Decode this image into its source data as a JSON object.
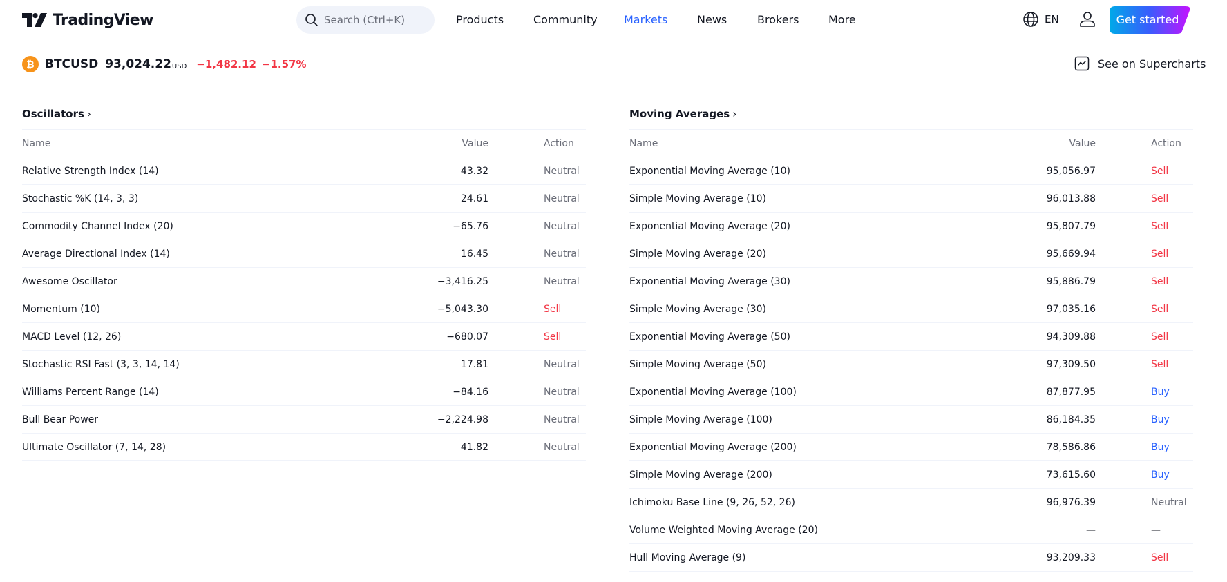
{
  "header": {
    "logo_text": "TradingView",
    "search_placeholder": "Search (Ctrl+K)",
    "nav": [
      {
        "label": "Products",
        "active": false
      },
      {
        "label": "Community",
        "active": false
      },
      {
        "label": "Markets",
        "active": true
      },
      {
        "label": "News",
        "active": false
      },
      {
        "label": "Brokers",
        "active": false
      },
      {
        "label": "More",
        "active": false
      }
    ],
    "language": "EN",
    "cta_label": "Get started",
    "icons": {
      "search": "search-icon",
      "globe": "globe-icon",
      "user": "user-icon",
      "supercharts": "chart-line-icon",
      "coin": "bitcoin-icon"
    }
  },
  "ticker": {
    "coin_glyph": "₿",
    "symbol": "BTCUSD",
    "price": "93,024.22",
    "currency": "USD",
    "change": "−1,482.12",
    "change_percent": "−1.57%",
    "supercharts_label": "See on Supercharts"
  },
  "colors": {
    "sell": "#f23645",
    "buy": "#2962ff",
    "neutral": "#6a6d78",
    "accent": "#2962ff",
    "coin": "#f7931a"
  },
  "oscillators": {
    "title": "Oscillators",
    "columns": {
      "name": "Name",
      "value": "Value",
      "action": "Action"
    },
    "rows": [
      {
        "name": "Relative Strength Index (14)",
        "value": "43.32",
        "action": "Neutral"
      },
      {
        "name": "Stochastic %K (14, 3, 3)",
        "value": "24.61",
        "action": "Neutral"
      },
      {
        "name": "Commodity Channel Index (20)",
        "value": "−65.76",
        "action": "Neutral"
      },
      {
        "name": "Average Directional Index (14)",
        "value": "16.45",
        "action": "Neutral"
      },
      {
        "name": "Awesome Oscillator",
        "value": "−3,416.25",
        "action": "Neutral"
      },
      {
        "name": "Momentum (10)",
        "value": "−5,043.30",
        "action": "Sell"
      },
      {
        "name": "MACD Level (12, 26)",
        "value": "−680.07",
        "action": "Sell"
      },
      {
        "name": "Stochastic RSI Fast (3, 3, 14, 14)",
        "value": "17.81",
        "action": "Neutral"
      },
      {
        "name": "Williams Percent Range (14)",
        "value": "−84.16",
        "action": "Neutral"
      },
      {
        "name": "Bull Bear Power",
        "value": "−2,224.98",
        "action": "Neutral"
      },
      {
        "name": "Ultimate Oscillator (7, 14, 28)",
        "value": "41.82",
        "action": "Neutral"
      }
    ]
  },
  "moving_averages": {
    "title": "Moving Averages",
    "columns": {
      "name": "Name",
      "value": "Value",
      "action": "Action"
    },
    "rows": [
      {
        "name": "Exponential Moving Average (10)",
        "value": "95,056.97",
        "action": "Sell"
      },
      {
        "name": "Simple Moving Average (10)",
        "value": "96,013.88",
        "action": "Sell"
      },
      {
        "name": "Exponential Moving Average (20)",
        "value": "95,807.79",
        "action": "Sell"
      },
      {
        "name": "Simple Moving Average (20)",
        "value": "95,669.94",
        "action": "Sell"
      },
      {
        "name": "Exponential Moving Average (30)",
        "value": "95,886.79",
        "action": "Sell"
      },
      {
        "name": "Simple Moving Average (30)",
        "value": "97,035.16",
        "action": "Sell"
      },
      {
        "name": "Exponential Moving Average (50)",
        "value": "94,309.88",
        "action": "Sell"
      },
      {
        "name": "Simple Moving Average (50)",
        "value": "97,309.50",
        "action": "Sell"
      },
      {
        "name": "Exponential Moving Average (100)",
        "value": "87,877.95",
        "action": "Buy"
      },
      {
        "name": "Simple Moving Average (100)",
        "value": "86,184.35",
        "action": "Buy"
      },
      {
        "name": "Exponential Moving Average (200)",
        "value": "78,586.86",
        "action": "Buy"
      },
      {
        "name": "Simple Moving Average (200)",
        "value": "73,615.60",
        "action": "Buy"
      },
      {
        "name": "Ichimoku Base Line (9, 26, 52, 26)",
        "value": "96,976.39",
        "action": "Neutral"
      },
      {
        "name": "Volume Weighted Moving Average (20)",
        "value": "—",
        "action": "—"
      },
      {
        "name": "Hull Moving Average (9)",
        "value": "93,209.33",
        "action": "Sell"
      }
    ]
  }
}
